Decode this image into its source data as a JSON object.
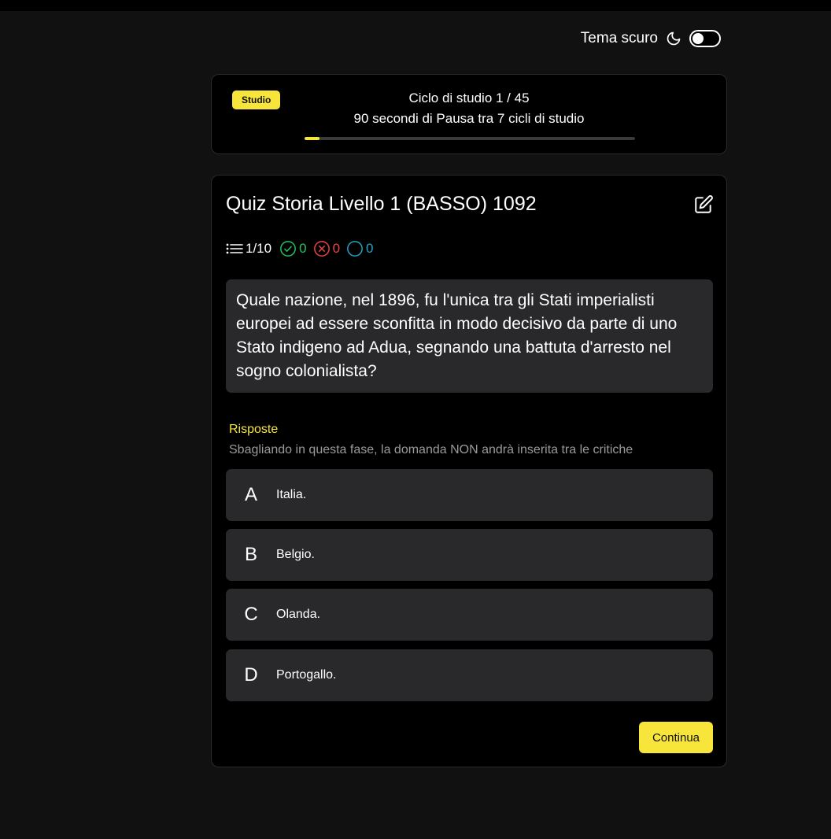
{
  "theme": {
    "label": "Tema scuro",
    "icon": "moon-icon",
    "dark_mode_enabled": true
  },
  "study_cycle": {
    "badge": "Studio",
    "title": "Ciclo di studio 1 / 45",
    "subtitle": "90 secondi di Pausa tra 7 cicli di studio",
    "progress_fraction": 0.045
  },
  "quiz": {
    "title": "Quiz Storia Livello 1 (BASSO) 1092",
    "edit_icon": "edit-icon",
    "stats": {
      "progress": "1/10",
      "correct": "0",
      "wrong": "0",
      "skipped": "0"
    },
    "question": "Quale nazione, nel 1896, fu l'unica tra gli Stati imperialisti europei ad essere sconfitta in modo decisivo da parte di uno Stato indigeno ad Adua, segnando una battuta d'arresto nel sogno colonialista?",
    "answers_label": "Risposte",
    "answers_hint": "Sbagliando in questa fase, la domanda NON andrà inserita tra le critiche",
    "answers": [
      {
        "letter": "A",
        "text": "Italia."
      },
      {
        "letter": "B",
        "text": "Belgio."
      },
      {
        "letter": "C",
        "text": "Olanda."
      },
      {
        "letter": "D",
        "text": "Portogallo."
      }
    ],
    "continue_label": "Continua"
  },
  "colors": {
    "accent": "#f7e53b",
    "background": "#111111",
    "card": "#000000",
    "surface": "#29292b",
    "correct": "#22c55e",
    "wrong": "#ef4444",
    "skipped": "#22a6c7"
  }
}
